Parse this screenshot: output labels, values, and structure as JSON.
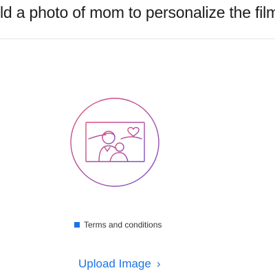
{
  "header": {
    "text": "ld a photo of mom to personalize the film."
  },
  "illustration": {
    "icon": "photo-upload-illustration",
    "stroke_color_start": "#e0507a",
    "stroke_color_end": "#7b4fc7"
  },
  "terms": {
    "label": "Terms and conditions",
    "checkbox_color": "#1a74e8"
  },
  "upload": {
    "label": "Upload Image",
    "chevron": "›",
    "color": "#1a74e8"
  }
}
